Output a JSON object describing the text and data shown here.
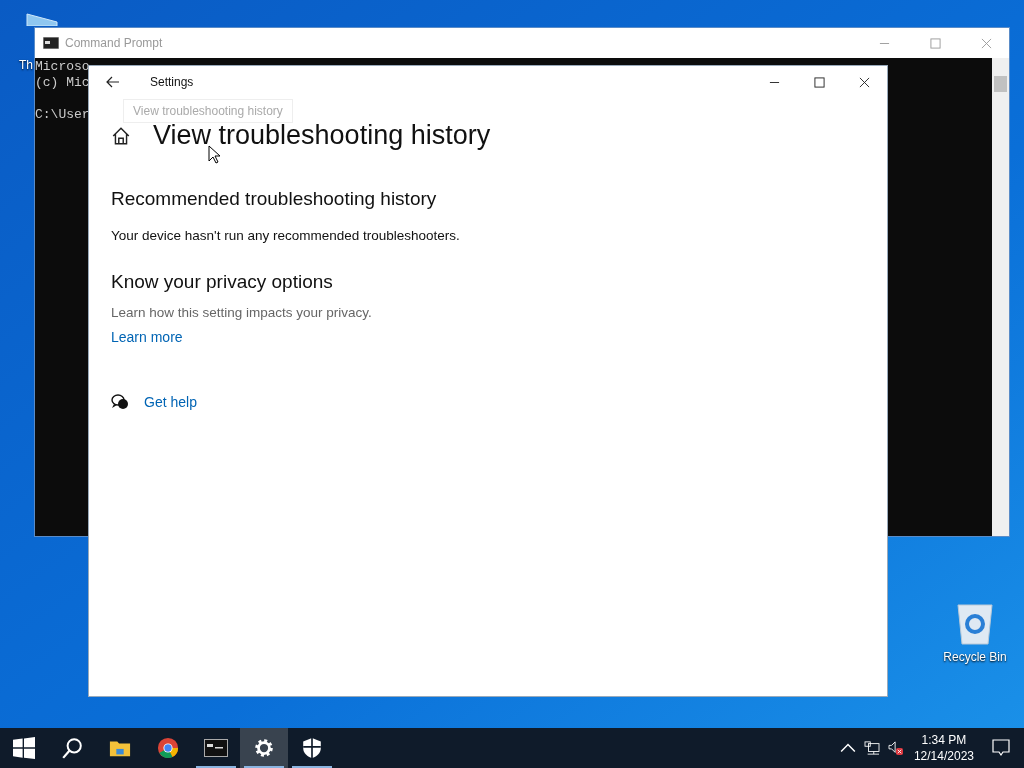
{
  "desktop": {
    "icons": [
      {
        "kind": "generic",
        "label": "Th"
      },
      {
        "kind": "recycle",
        "label": "Recycle Bin"
      }
    ]
  },
  "cmd_window": {
    "title": "Command Prompt",
    "lines": [
      "Microso",
      "(c) Mic"
    ],
    "prompt": "C:\\User"
  },
  "settings_window": {
    "title": "Settings",
    "tooltip": "View troubleshooting history",
    "page_title": "View troubleshooting history",
    "sections": [
      {
        "kind": "body",
        "heading": "Recommended troubleshooting history",
        "text": "Your device hasn't run any recommended troubleshooters."
      },
      {
        "kind": "muted",
        "heading": "Know your privacy options",
        "text": "Learn how this setting impacts your privacy.",
        "link": "Learn more"
      }
    ],
    "help_link": "Get help"
  },
  "taskbar": {
    "apps": [
      {
        "kind": "explorer",
        "running": false,
        "selected": false
      },
      {
        "kind": "chrome",
        "running": false,
        "selected": false
      },
      {
        "kind": "cmd",
        "running": true,
        "selected": false
      },
      {
        "kind": "settings",
        "running": true,
        "selected": true
      },
      {
        "kind": "security",
        "running": true,
        "selected": false
      }
    ],
    "clock": {
      "time": "1:34 PM",
      "date": "12/14/2023"
    }
  }
}
